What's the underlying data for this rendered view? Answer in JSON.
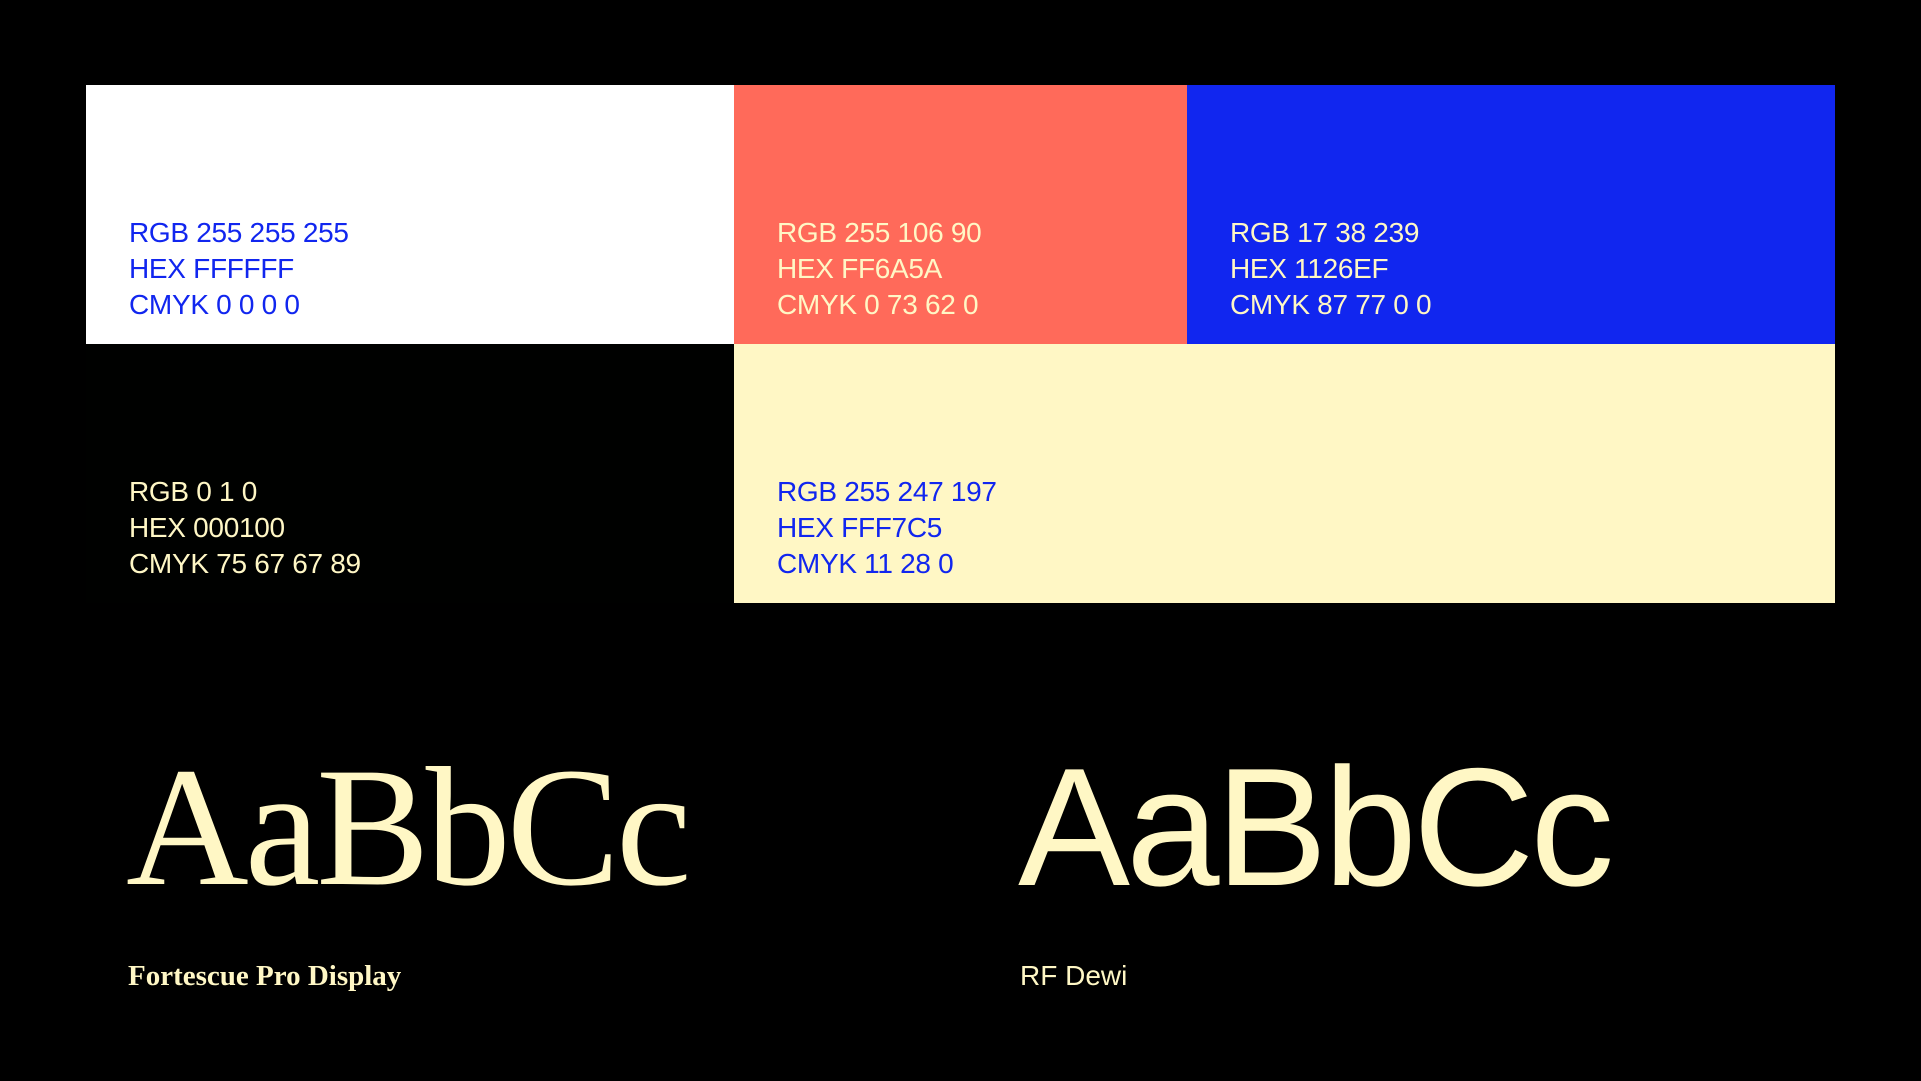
{
  "palette": {
    "white": {
      "color": "#FFFFFF",
      "text_color": "#1126EF",
      "rgb": "RGB 255 255 255",
      "hex": "HEX FFFFFF",
      "cmyk": "CMYK 0 0 0 0"
    },
    "coral": {
      "color": "#FF6A5A",
      "text_color": "#FFF7C5",
      "rgb": "RGB 255 106 90",
      "hex": "HEX FF6A5A",
      "cmyk": "CMYK 0 73 62 0"
    },
    "blue": {
      "color": "#1126EF",
      "text_color": "#FFF7C5",
      "rgb": "RGB 17 38 239",
      "hex": "HEX 1126EF",
      "cmyk": "CMYK 87 77 0 0"
    },
    "black": {
      "color": "#000100",
      "text_color": "#FFF7C5",
      "rgb": "RGB 0 1 0",
      "hex": "HEX 000100",
      "cmyk": "CMYK 75 67 67 89"
    },
    "cream": {
      "color": "#FFF7C5",
      "text_color": "#1126EF",
      "rgb": "RGB 255 247 197",
      "hex": "HEX FFF7C5",
      "cmyk": "CMYK 11 28 0"
    }
  },
  "typography": {
    "serif": {
      "sample": "AaBbCc",
      "name": "Fortescue Pro Display"
    },
    "sans": {
      "sample": "AaBbCc",
      "name": "RF Dewi"
    }
  }
}
